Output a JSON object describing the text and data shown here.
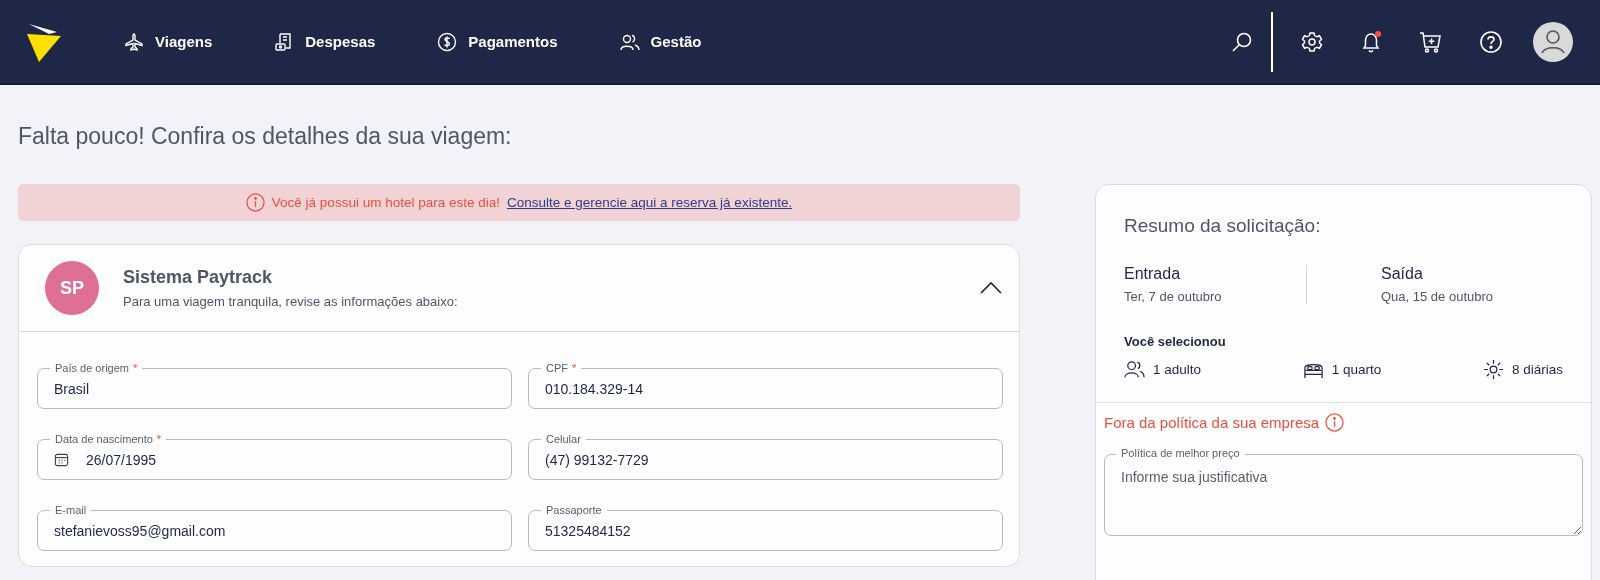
{
  "nav": {
    "items": [
      {
        "label": "Viagens"
      },
      {
        "label": "Despesas"
      },
      {
        "label": "Pagamentos"
      },
      {
        "label": "Gestão"
      }
    ],
    "notification": true
  },
  "page_title": "Falta pouco! Confira os detalhes da sua viagem:",
  "alert": {
    "text": "Você já possui um hotel para este dia!",
    "link": "Consulte e gerencie aqui a reserva já existente."
  },
  "traveler": {
    "initials": "SP",
    "name": "Sistema Paytrack",
    "subtitle": "Para uma viagem tranquila, revise as informações abaixo:",
    "expanded": true,
    "fields": [
      {
        "label": "País de origem",
        "required_mark": "*",
        "value": "Brasil",
        "kind": "text"
      },
      {
        "label": "CPF",
        "required_mark": "*",
        "value": "010.184.329-14",
        "kind": "text"
      },
      {
        "label": "Data de nascimento",
        "required_mark": "*",
        "value": "26/07/1995",
        "kind": "date"
      },
      {
        "label": "Celular",
        "value": "(47) 99132-7729",
        "kind": "text"
      },
      {
        "label": "E-mail",
        "value": "stefanievoss95@gmail.com",
        "kind": "text"
      },
      {
        "label": "Passaporte",
        "value": "51325484152",
        "kind": "text"
      }
    ]
  },
  "summary": {
    "title": "Resumo da solicitação:",
    "checkin": {
      "label": "Entrada",
      "date": "Ter, 7 de outubro"
    },
    "checkout": {
      "label": "Saída",
      "date": "Qua, 15 de outubro"
    },
    "selected_label": "Você selecionou",
    "selected": [
      {
        "text": "1 adulto"
      },
      {
        "text": "1 quarto"
      },
      {
        "text": "8 diárias"
      }
    ],
    "policy_warning": "Fora da política da sua empresa",
    "justification": {
      "label": "Política de melhor preço",
      "placeholder": "Informe sua justificativa"
    }
  }
}
